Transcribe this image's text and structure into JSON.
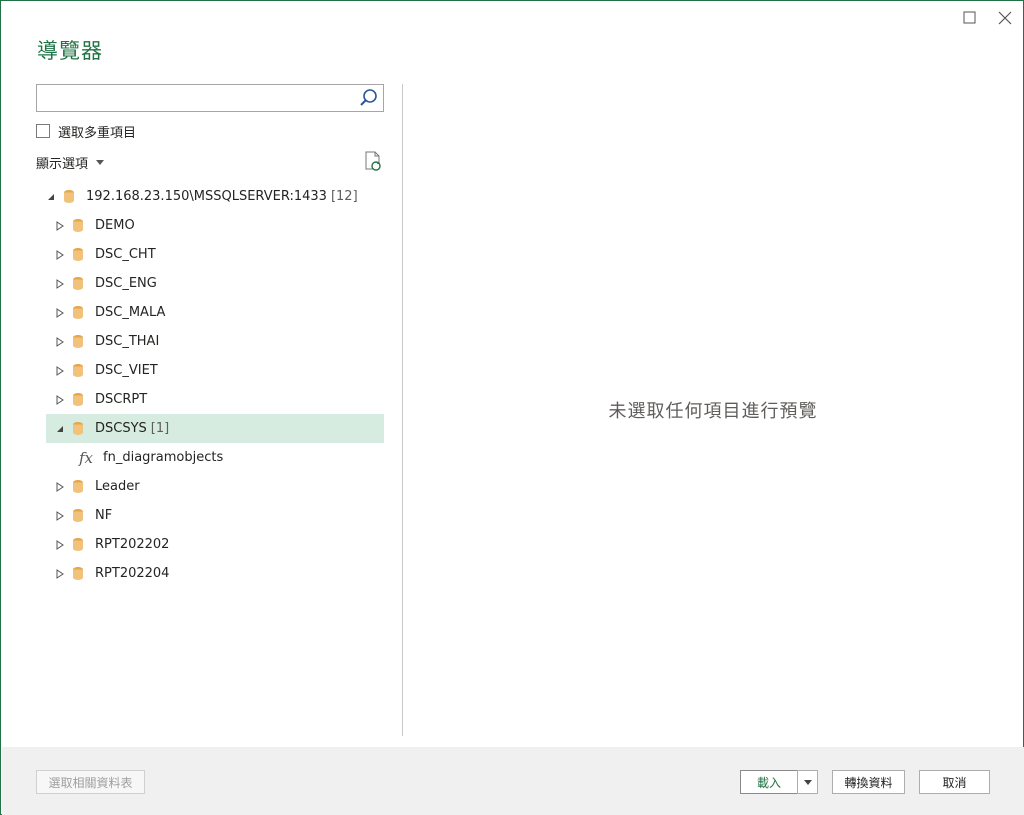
{
  "window": {
    "title": "導覽器",
    "icons": [
      "maximize-icon",
      "close-icon"
    ]
  },
  "search": {
    "value": "",
    "placeholder": ""
  },
  "multi_select": {
    "label": "選取多重項目",
    "checked": false
  },
  "display_options": {
    "label": "顯示選項"
  },
  "tree": {
    "root": {
      "label": "192.168.23.150\\MSSQLSERVER:1433",
      "count": "[12]"
    },
    "databases": [
      {
        "label": "DEMO",
        "count": ""
      },
      {
        "label": "DSC_CHT",
        "count": ""
      },
      {
        "label": "DSC_ENG",
        "count": ""
      },
      {
        "label": "DSC_MALA",
        "count": ""
      },
      {
        "label": "DSC_THAI",
        "count": ""
      },
      {
        "label": "DSC_VIET",
        "count": ""
      },
      {
        "label": "DSCRPT",
        "count": ""
      },
      {
        "label": "DSCSYS",
        "count": "[1]"
      },
      {
        "label": "Leader",
        "count": ""
      },
      {
        "label": "NF",
        "count": ""
      },
      {
        "label": "RPT202202",
        "count": ""
      },
      {
        "label": "RPT202204",
        "count": ""
      }
    ],
    "function_item": {
      "icon": "fx",
      "label": "fn_diagramobjects"
    }
  },
  "preview": {
    "message": "未選取任何項目進行預覽"
  },
  "footer": {
    "select_related": "選取相關資料表",
    "load": "載入",
    "transform": "轉換資料",
    "cancel": "取消"
  },
  "colors": {
    "accent": "#217346",
    "selected_row": "#d6ece0",
    "db_icon": "#f0c27b"
  }
}
